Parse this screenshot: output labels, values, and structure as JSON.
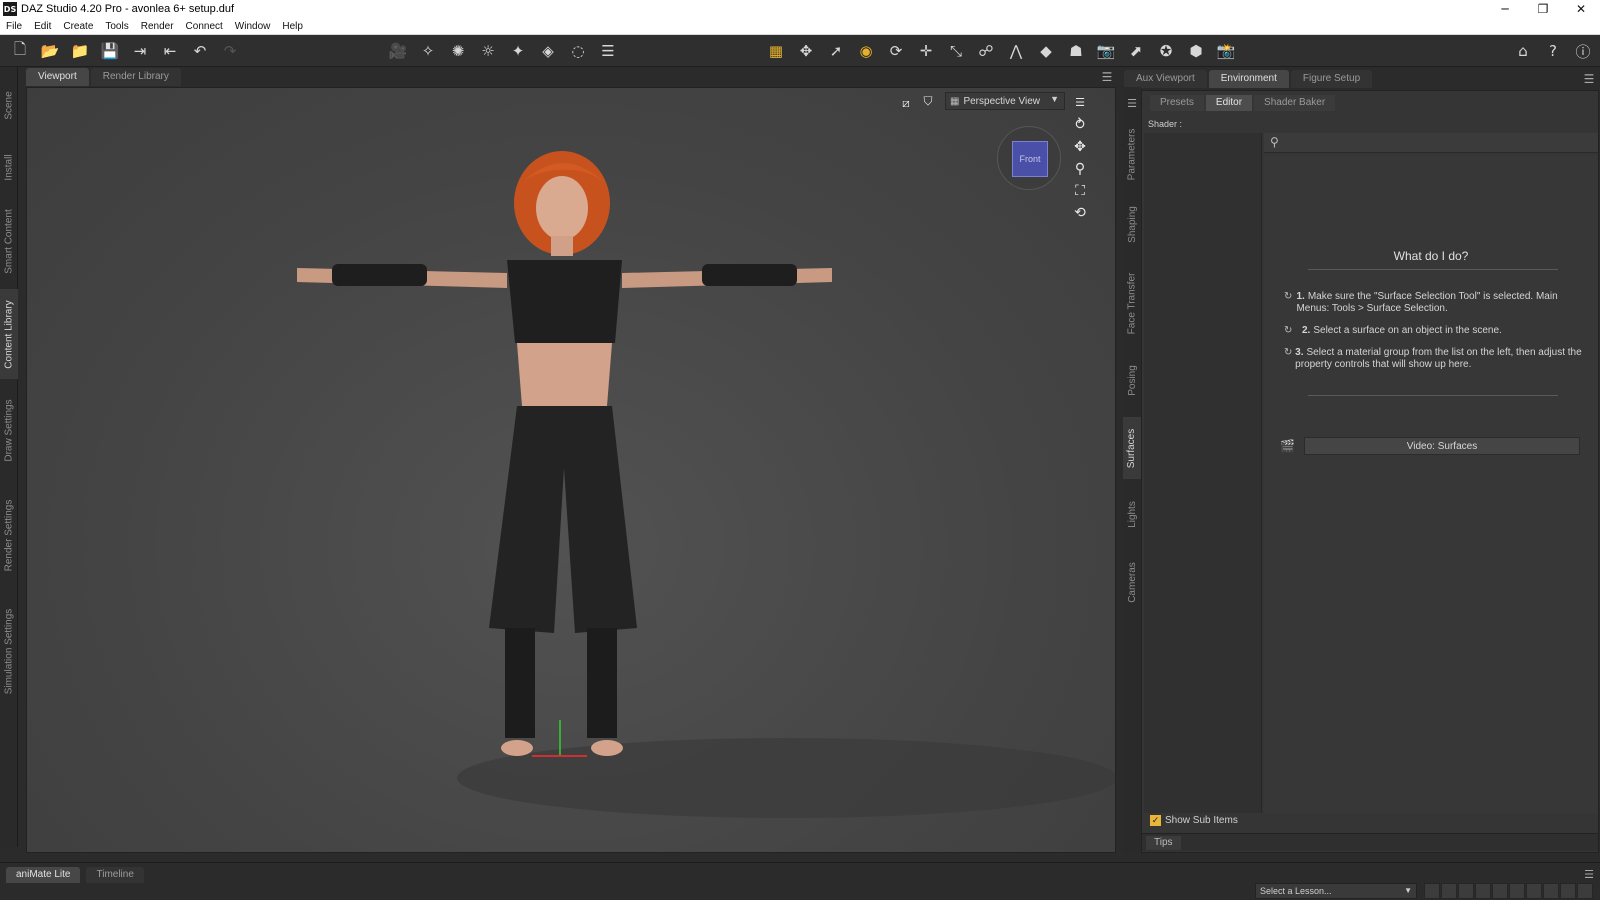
{
  "window": {
    "title": "DAZ Studio 4.20 Pro - avonlea 6+ setup.duf",
    "app_icon_text": "DS",
    "minimize": "─",
    "restore": "❐",
    "close": "✕"
  },
  "menu": [
    "File",
    "Edit",
    "Create",
    "Tools",
    "Render",
    "Connect",
    "Window",
    "Help"
  ],
  "left_tabs": [
    "Scene",
    "Install",
    "Smart Content",
    "Content Library",
    "Draw Settings",
    "Render Settings",
    "Simulation Settings"
  ],
  "viewport_tabs": [
    "Viewport",
    "Render Library"
  ],
  "viewport": {
    "view_mode": "Perspective View",
    "cube_label": "Front"
  },
  "right_tabs": [
    "Aux Viewport",
    "Environment",
    "Figure Setup"
  ],
  "right_vertical_tabs": [
    "Parameters",
    "Shaping",
    "Face Transfer",
    "Posing",
    "Surfaces",
    "Lights",
    "Cameras"
  ],
  "surfaces": {
    "sub_tabs": [
      "Presets",
      "Editor",
      "Shader Baker"
    ],
    "shader_label": "Shader :",
    "search_placeholder": "",
    "help_title": "What do I do?",
    "steps": [
      {
        "num": "1.",
        "text": "Make sure the \"Surface Selection Tool\" is selected. Main Menus: Tools > Surface Selection."
      },
      {
        "num": "2.",
        "text": "Select a surface on an object in the scene."
      },
      {
        "num": "3.",
        "text": "Select a material group from the list on the left, then adjust the property controls that will show up here."
      }
    ],
    "video_button": "Video: Surfaces",
    "show_sub_items": "Show Sub Items",
    "tips_tab": "Tips"
  },
  "bottom": {
    "tabs": [
      "aniMate Lite",
      "Timeline"
    ],
    "lesson_select": "Select a Lesson..."
  },
  "colors": {
    "accent": "#e6b12a",
    "viewport_bg": "#4a4a4a",
    "panel_bg": "#353535",
    "cube": "#4a4fa8"
  }
}
